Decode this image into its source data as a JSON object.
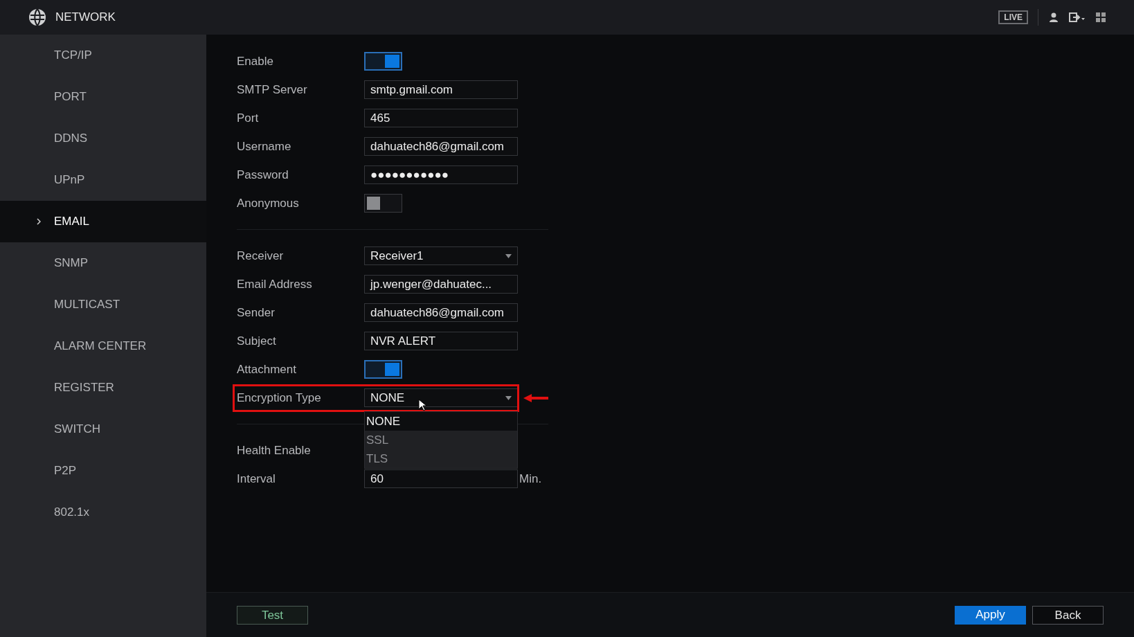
{
  "header": {
    "title": "NETWORK",
    "live_label": "LIVE"
  },
  "sidebar": {
    "items": [
      {
        "label": "TCP/IP",
        "selected": false
      },
      {
        "label": "PORT",
        "selected": false
      },
      {
        "label": "DDNS",
        "selected": false
      },
      {
        "label": "UPnP",
        "selected": false
      },
      {
        "label": "EMAIL",
        "selected": true
      },
      {
        "label": "SNMP",
        "selected": false
      },
      {
        "label": "MULTICAST",
        "selected": false
      },
      {
        "label": "ALARM CENTER",
        "selected": false
      },
      {
        "label": "REGISTER",
        "selected": false
      },
      {
        "label": "SWITCH",
        "selected": false
      },
      {
        "label": "P2P",
        "selected": false
      },
      {
        "label": "802.1x",
        "selected": false
      }
    ]
  },
  "form": {
    "rows": [
      {
        "kind": "toggle",
        "label": "Enable",
        "on": true
      },
      {
        "kind": "text",
        "label": "SMTP Server",
        "value": "smtp.gmail.com"
      },
      {
        "kind": "text",
        "label": "Port",
        "value": "465"
      },
      {
        "kind": "text",
        "label": "Username",
        "value": "dahuatech86@gmail.com"
      },
      {
        "kind": "text",
        "label": "Password",
        "value": "●●●●●●●●●●●"
      },
      {
        "kind": "toggle",
        "label": "Anonymous",
        "on": false
      },
      {
        "kind": "divider"
      },
      {
        "kind": "select",
        "label": "Receiver",
        "value": "Receiver1"
      },
      {
        "kind": "text",
        "label": "Email Address",
        "value": "jp.wenger@dahuatec..."
      },
      {
        "kind": "text",
        "label": "Sender",
        "value": "dahuatech86@gmail.com"
      },
      {
        "kind": "text",
        "label": "Subject",
        "value": "NVR ALERT"
      },
      {
        "kind": "toggle",
        "label": "Attachment",
        "on": true
      },
      {
        "kind": "select",
        "label": "Encryption Type",
        "value": "NONE",
        "highlighted": true,
        "expanded": true,
        "options": [
          {
            "label": "NONE",
            "selected": true
          },
          {
            "label": "SSL",
            "selected": false
          },
          {
            "label": "TLS",
            "selected": false
          }
        ]
      },
      {
        "kind": "divider"
      },
      {
        "kind": "label",
        "label": "Health Enable"
      },
      {
        "kind": "text",
        "label": "Interval",
        "value": "60",
        "unit": "Min."
      }
    ]
  },
  "footer": {
    "test_button": "Test",
    "apply_button": "Apply",
    "back_button": "Back"
  }
}
